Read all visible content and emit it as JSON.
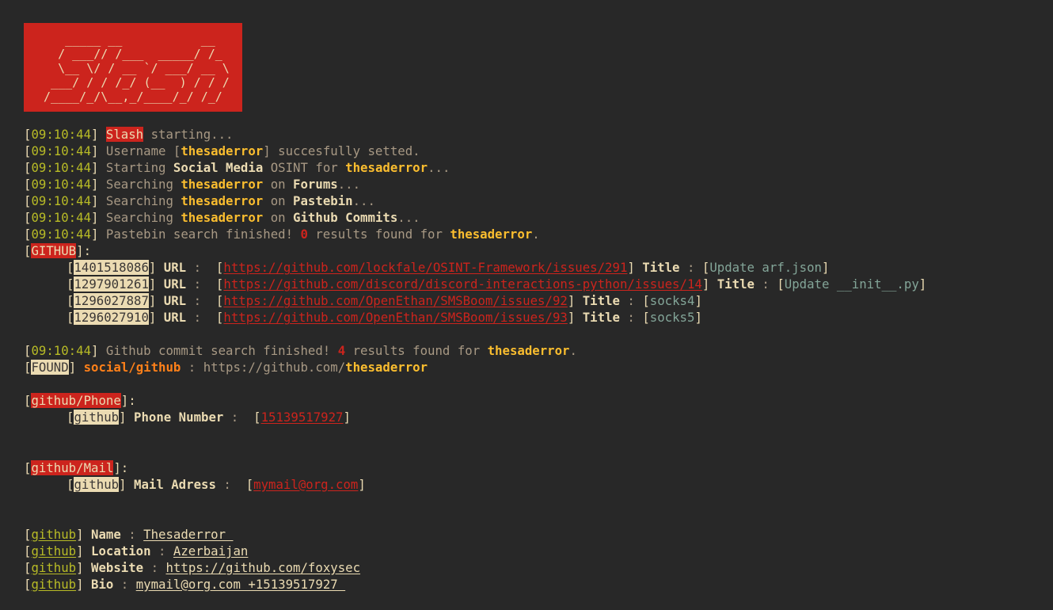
{
  "logo_ascii": "    _____ __           __\n   / ___// /___  _____/ /_\n   \\__ \\/ / __ `/ ___/ __ \\\n  ___/ / / /_/ (__  ) / / /\n /____/_/\\__,_/____/_/ /_/",
  "ts": "09:10:44",
  "app_name": "Slash",
  "starting_suffix": " starting...",
  "username_line": {
    "pre": "Username [",
    "user": "thesaderror",
    "post": "] succesfully setted."
  },
  "start_osint": {
    "pre": "Starting ",
    "mid": "Social Media",
    "post": " OSINT for ",
    "user": "thesaderror",
    "dots": "..."
  },
  "search_forums": {
    "pre": "Searching ",
    "user": "thesaderror",
    "mid": " on ",
    "target": "Forums",
    "dots": "..."
  },
  "search_paste": {
    "pre": "Searching ",
    "user": "thesaderror",
    "mid": " on ",
    "target": "Pastebin",
    "dots": "..."
  },
  "search_commits": {
    "pre": "Searching ",
    "user": "thesaderror",
    "mid": " on ",
    "target": "Github Commits",
    "dots": "..."
  },
  "pastebin_done": {
    "pre": "Pastebin search finished! ",
    "count": "0",
    "post": " results found for ",
    "user": "thesaderror",
    "dot": "."
  },
  "github_tag": "GITHUB",
  "github_results": [
    {
      "id": "1401518086",
      "url": "https://github.com/lockfale/OSINT-Framework/issues/291",
      "title": "Update arf.json"
    },
    {
      "id": "1297901261",
      "url": "https://github.com/discord/discord-interactions-python/issues/14",
      "title": "Update __init__.py"
    },
    {
      "id": "1296027887",
      "url": "https://github.com/OpenEthan/SMSBoom/issues/92",
      "title": "socks4"
    },
    {
      "id": "1296027910",
      "url": "https://github.com/OpenEthan/SMSBoom/issues/93",
      "title": "socks5"
    }
  ],
  "commits_done": {
    "pre": "Github commit search finished! ",
    "count": "4",
    "post": " results found for ",
    "user": "thesaderror",
    "dot": "."
  },
  "found": {
    "tag": "FOUND",
    "key": "social/github",
    "pre_url": " : https://github.com/",
    "user": "thesaderror"
  },
  "phone_section": {
    "tag": "github/Phone",
    "row_tag": "github",
    "label": "Phone Number",
    "value": "15139517927"
  },
  "mail_section": {
    "tag": "github/Mail",
    "row_tag": "github",
    "label": "Mail Adress",
    "value": "mymail@org.com"
  },
  "profile": {
    "tag": "github",
    "name_label": "Name",
    "name_value": "Thesaderror ",
    "loc_label": "Location",
    "loc_value": "Azerbaijan",
    "web_label": "Website",
    "web_value": "https://github.com/foxysec",
    "bio_label": "Bio",
    "bio_value": "mymail@org.com +15139517927 "
  },
  "glue": {
    "lbr": "[",
    "rbr": "]",
    "colon_sp": ":",
    "sep": " : ",
    "dots": "..."
  }
}
